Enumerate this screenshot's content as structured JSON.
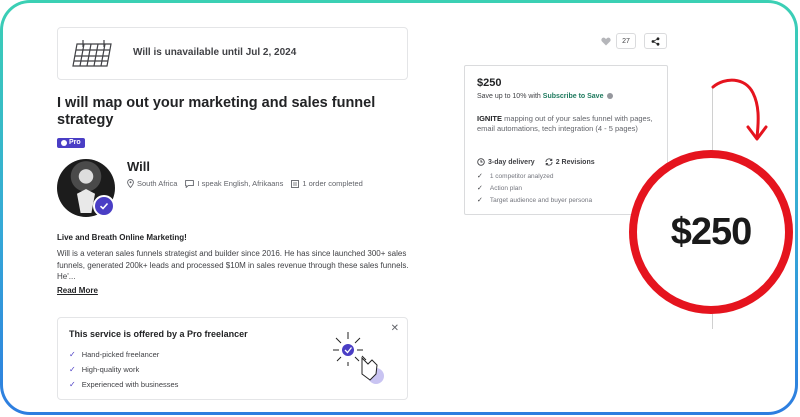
{
  "banner": {
    "text": "Will is unavailable until Jul 2, 2024",
    "icon": "calendar-icon"
  },
  "gig": {
    "title": "I will map out your marketing and sales funnel strategy",
    "badge": "Pro"
  },
  "seller": {
    "name": "Will",
    "country": "South Africa",
    "languages": "I speak English, Afrikaans",
    "orders": "1 order completed"
  },
  "about": {
    "heading": "Live and Breath Online Marketing!",
    "text": "Will is a veteran sales funnels strategist and builder since 2016. He has since launched 300+ sales funnels, generated 200k+ leads and processed $10M in sales revenue through these sales funnels. He'...",
    "read_more": "Read More"
  },
  "pro_card": {
    "heading": "This service is offered by a Pro freelancer",
    "items": [
      "Hand-picked freelancer",
      "High-quality work",
      "Experienced with businesses"
    ]
  },
  "actions": {
    "likes": "27"
  },
  "package": {
    "price": "$250",
    "save_prefix": "Save up to 10% with",
    "save_link": "Subscribe to Save",
    "desc_bold": "IGNITE",
    "desc_rest": "mapping out of your sales funnel with pages, email automations, tech integration (4 - 5 pages)",
    "delivery": "3-day delivery",
    "revisions": "2 Revisions",
    "features": [
      "1 competitor analyzed",
      "Action plan",
      "Target audience and buyer persona"
    ]
  },
  "highlight": {
    "price": "$250"
  },
  "colors": {
    "pro": "#4a3ec5",
    "highlight_ring": "#e5141e",
    "frame_top": "#3bd0b4",
    "frame_bottom": "#2d7de0"
  }
}
